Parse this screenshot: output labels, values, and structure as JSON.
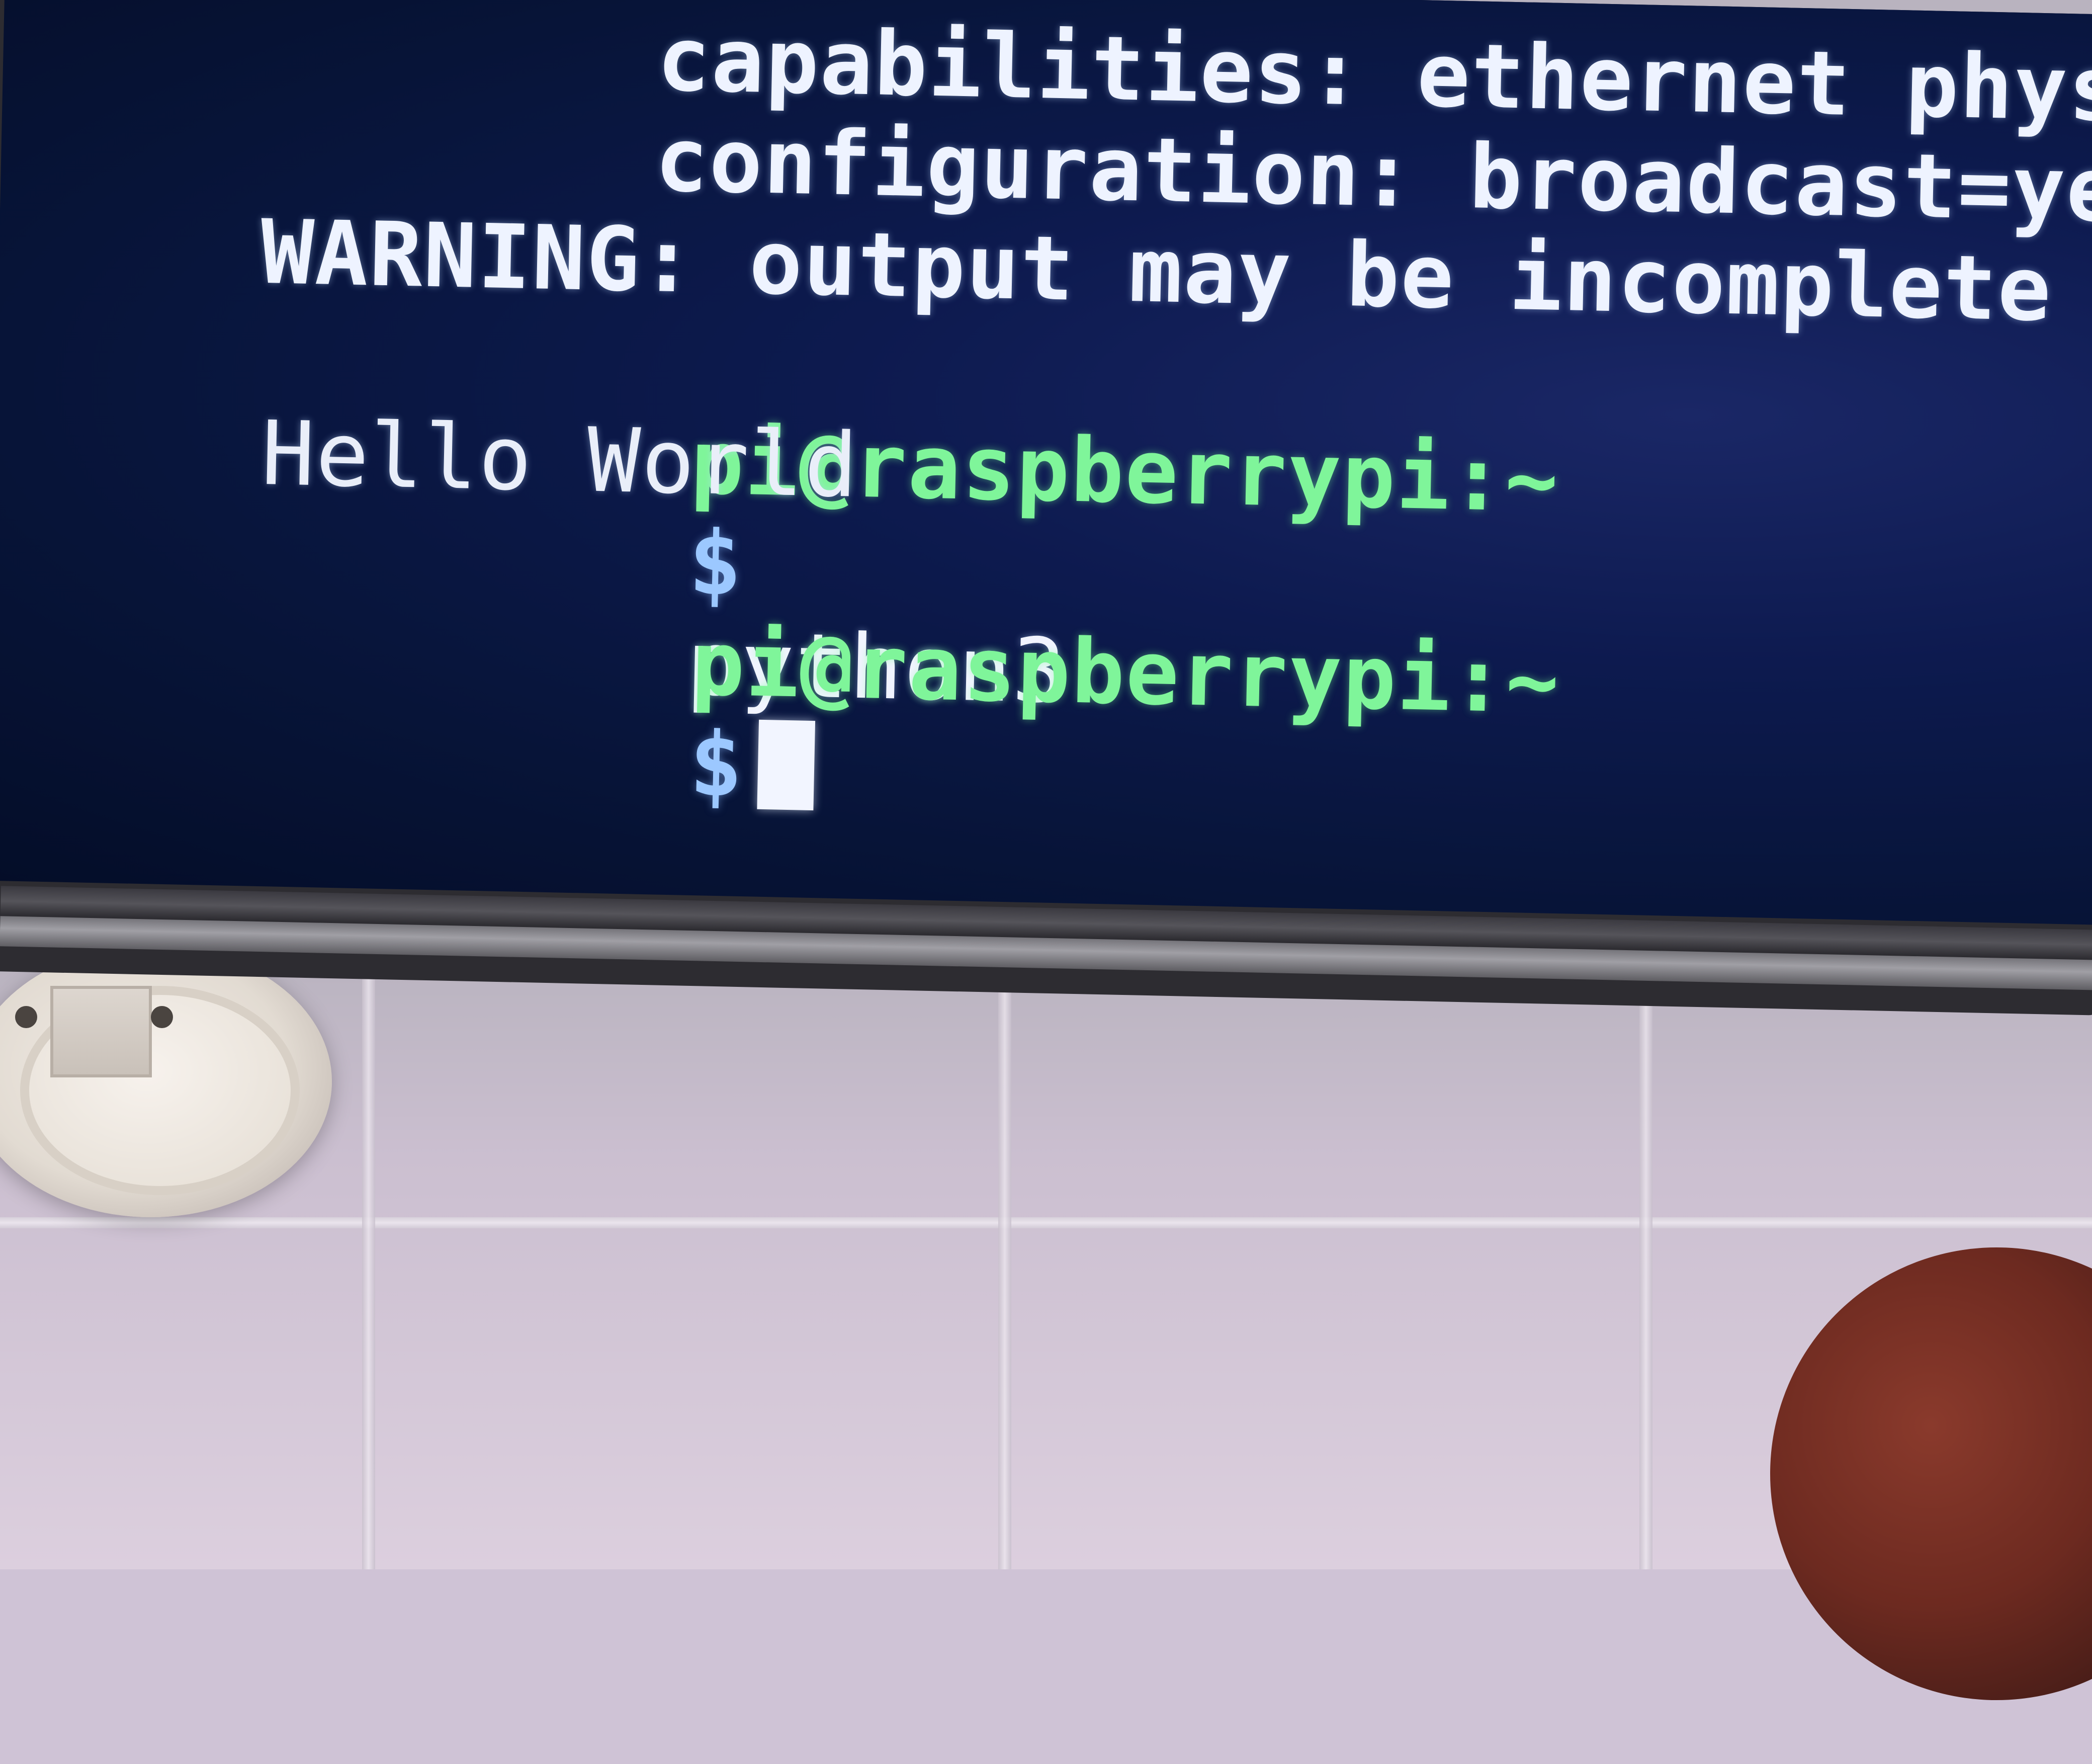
{
  "terminal": {
    "lines": {
      "capabilities": "capabilities: ethernet phys",
      "configuration": "configuration: broadcast=ye",
      "warning": "WARNING: output may be incomplete"
    },
    "prompt1": {
      "user_host": "pi@raspberrypi:~",
      "symbol": "$",
      "command": "python3"
    },
    "output": "Hello World",
    "prompt2": {
      "user_host": "pi@raspberrypi:~",
      "symbol": "$"
    }
  }
}
